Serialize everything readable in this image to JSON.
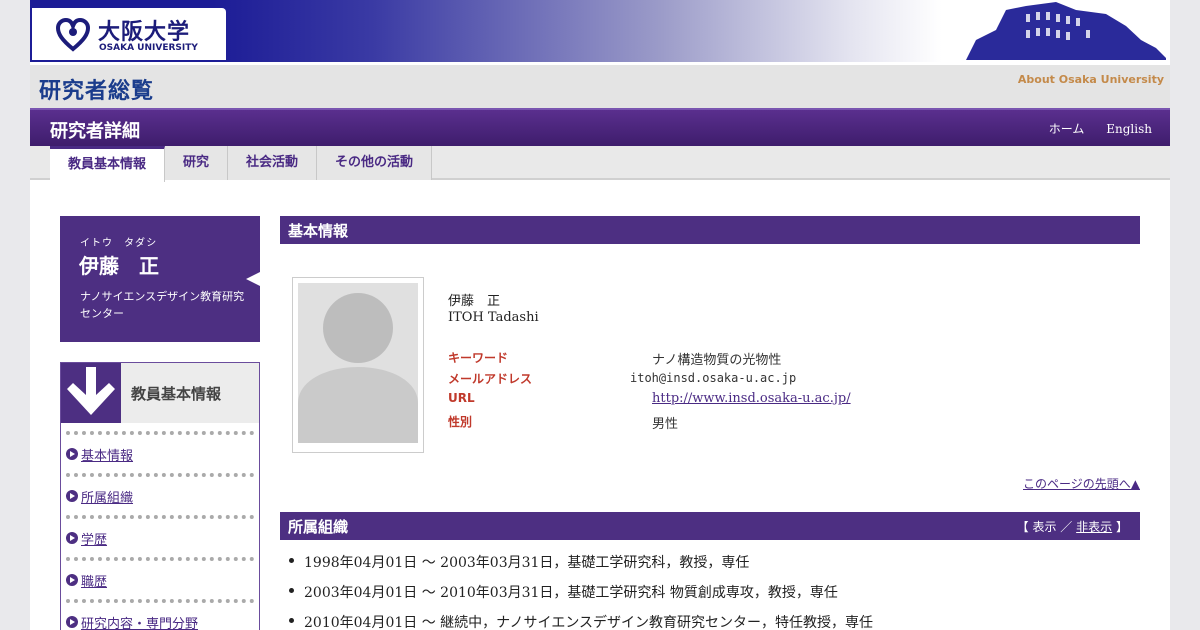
{
  "header": {
    "logo_jp": "大阪大学",
    "logo_en": "OSAKA UNIVERSITY",
    "site_title": "研究者総覧",
    "about_link": "About Osaka University",
    "section_title": "研究者詳細",
    "links": {
      "home": "ホーム",
      "english": "English"
    }
  },
  "tabs": [
    {
      "label": "教員基本情報",
      "active": true
    },
    {
      "label": "研究",
      "active": false
    },
    {
      "label": "社会活動",
      "active": false
    },
    {
      "label": "その他の活動",
      "active": false
    }
  ],
  "profile": {
    "kana": "イトウ　タダシ",
    "name": "伊藤　正",
    "affiliation": "ナノサイエンスデザイン教育研究センター"
  },
  "side_menu": {
    "title": "教員基本情報",
    "items": [
      "基本情報",
      "所属組織",
      "学歴",
      "職歴",
      "研究内容・専門分野"
    ]
  },
  "basic_info": {
    "heading": "基本情報",
    "name_jp": "伊藤　正",
    "name_en": "ITOH Tadashi",
    "fields": [
      {
        "label": "キーワード",
        "value": "ナノ構造物質の光物性"
      },
      {
        "label": "メールアドレス",
        "value": "itoh@insd.osaka-u.ac.jp"
      },
      {
        "label": "URL",
        "value": "http://www.insd.osaka-u.ac.jp/"
      },
      {
        "label": "性別",
        "value": "男性"
      }
    ],
    "page_top": "このページの先頭へ▲"
  },
  "organization": {
    "heading": "所属組織",
    "toggle": {
      "open_bracket": "【",
      "show": "表示",
      "sep": "／",
      "hide": "非表示",
      "close_bracket": "】"
    },
    "entries": [
      "1998年04月01日 ～ 2003年03月31日，基礎工学研究科，教授，専任",
      "2003年04月01日 ～ 2010年03月31日，基礎工学研究科 物質創成専攻，教授，専任",
      "2010年04月01日 ～ 継続中，ナノサイエンスデザイン教育研究センター，特任教授，専任"
    ]
  },
  "colors": {
    "brand_navy": "#1c1c96",
    "purple": "#4d2f82",
    "label_red": "#c0392b",
    "about_orange": "#c48a4a"
  }
}
